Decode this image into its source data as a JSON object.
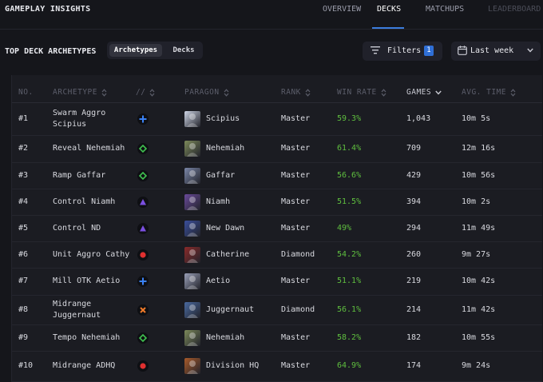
{
  "app": {
    "title": "GAMEPLAY INSIGHTS",
    "nav": [
      "OVERVIEW",
      "DECKS",
      "MATCHUPS",
      "LEADERBOARD"
    ],
    "active_nav": "DECKS"
  },
  "toolbar": {
    "section_title": "TOP DECK ARCHETYPES",
    "segment_options": [
      "Archetypes",
      "Decks"
    ],
    "segment_selected": "Archetypes",
    "filters_label": "Filters",
    "filters_count": "1",
    "date_range": "Last week"
  },
  "table": {
    "columns": [
      "NO.",
      "ARCHETYPE",
      "//",
      "PARAGON",
      "RANK",
      "WIN RATE",
      "GAMES",
      "AVG. TIME"
    ],
    "sorted_column": "GAMES",
    "rows": [
      {
        "no": "#1",
        "archetype_1": "Swarm Aggro",
        "archetype_2": "Scipius",
        "faction": "blue-cross",
        "paragon": "Scipius",
        "rank": "Master",
        "win_rate": "59.3%",
        "games": "1,043",
        "avg_time": "10m 5s"
      },
      {
        "no": "#2",
        "archetype_1": "Reveal Nehemiah",
        "archetype_2": "",
        "faction": "green-diamond",
        "paragon": "Nehemiah",
        "rank": "Master",
        "win_rate": "61.4%",
        "games": "709",
        "avg_time": "12m 16s"
      },
      {
        "no": "#3",
        "archetype_1": "Ramp Gaffar",
        "archetype_2": "",
        "faction": "green-diamond",
        "paragon": "Gaffar",
        "rank": "Master",
        "win_rate": "56.6%",
        "games": "429",
        "avg_time": "10m 56s"
      },
      {
        "no": "#4",
        "archetype_1": "Control Niamh",
        "archetype_2": "",
        "faction": "purple-triangle",
        "paragon": "Niamh",
        "rank": "Master",
        "win_rate": "51.5%",
        "games": "394",
        "avg_time": "10m 2s"
      },
      {
        "no": "#5",
        "archetype_1": "Control ND",
        "archetype_2": "",
        "faction": "purple-triangle",
        "paragon": "New Dawn",
        "rank": "Master",
        "win_rate": "49%",
        "games": "294",
        "avg_time": "11m 49s"
      },
      {
        "no": "#6",
        "archetype_1": "Unit Aggro Cathy",
        "archetype_2": "",
        "faction": "red-circle",
        "paragon": "Catherine",
        "rank": "Diamond",
        "win_rate": "54.2%",
        "games": "260",
        "avg_time": "9m 27s"
      },
      {
        "no": "#7",
        "archetype_1": "Mill OTK Aetio",
        "archetype_2": "",
        "faction": "blue-cross",
        "paragon": "Aetio",
        "rank": "Master",
        "win_rate": "51.1%",
        "games": "219",
        "avg_time": "10m 42s"
      },
      {
        "no": "#8",
        "archetype_1": "Midrange",
        "archetype_2": "Juggernaut",
        "faction": "orange-x",
        "paragon": "Juggernaut",
        "rank": "Diamond",
        "win_rate": "56.1%",
        "games": "214",
        "avg_time": "11m 42s"
      },
      {
        "no": "#9",
        "archetype_1": "Tempo Nehemiah",
        "archetype_2": "",
        "faction": "green-diamond",
        "paragon": "Nehemiah",
        "rank": "Master",
        "win_rate": "58.2%",
        "games": "182",
        "avg_time": "10m 55s"
      },
      {
        "no": "#10",
        "archetype_1": "Midrange ADHQ",
        "archetype_2": "",
        "faction": "red-circle",
        "paragon": "Division HQ",
        "rank": "Master",
        "win_rate": "64.9%",
        "games": "174",
        "avg_time": "9m 24s"
      }
    ]
  },
  "colors": {
    "accent": "#3b7ddd",
    "win_rate": "#5fbf3f",
    "faction_blue": "#3b82f6",
    "faction_green": "#3fbf4f",
    "faction_purple": "#7b4fe0",
    "faction_red": "#e03030",
    "faction_orange": "#f07a2a"
  }
}
